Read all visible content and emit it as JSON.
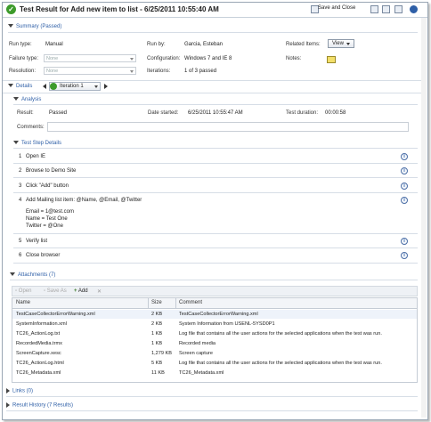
{
  "window": {
    "title": "Test Result for Add new item to list - 6/25/2011 10:55:40 AM",
    "save_close": "Save and Close"
  },
  "summary": {
    "header": "Summary (Passed)",
    "run_type_label": "Run type:",
    "run_type": "Manual",
    "run_by_label": "Run by:",
    "run_by": "Garcia, Esteban",
    "related_label": "Related Items:",
    "view_label": "View",
    "failure_label": "Failure type:",
    "failure_value": "None",
    "config_label": "Configuration:",
    "config": "Windows 7 and IE 8",
    "notes_label": "Notes:",
    "resolution_label": "Resolution:",
    "resolution_value": "None",
    "iterations_label": "Iterations:",
    "iterations": "1 of 3 passed"
  },
  "details": {
    "label": "Details",
    "iteration": "Iteration 1"
  },
  "analysis": {
    "header": "Analysis",
    "result_label": "Result:",
    "result": "Passed",
    "date_label": "Date started:",
    "date": "6/25/2011 10:55:47 AM",
    "duration_label": "Test duration:",
    "duration": "00:00:58",
    "comments_label": "Comments:"
  },
  "steps": {
    "header": "Test Step Details",
    "items": [
      {
        "num": "1",
        "text": "Open IE"
      },
      {
        "num": "2",
        "text": "Browse to Demo Site"
      },
      {
        "num": "3",
        "text": "Click \"Add\" button"
      },
      {
        "num": "4",
        "text": "Add Mailing list item: @Name, @Email, @Twitter"
      },
      {
        "num": "5",
        "text": "Verify list"
      },
      {
        "num": "6",
        "text": "Close browser"
      }
    ],
    "params": [
      "Email = 1@test.com",
      "Name = Test One",
      "Twitter = @One"
    ]
  },
  "attachments": {
    "header": "Attachments (7)",
    "toolbar": {
      "open": "Open",
      "save_as": "Save As",
      "add": "Add"
    },
    "columns": [
      "Name",
      "Size",
      "Comment"
    ],
    "rows": [
      {
        "name": "TestCaseCollectorErrorWarning.xml",
        "size": "2 KB",
        "comment": "TestCaseCollectorErrorWarning.xml"
      },
      {
        "name": "SystemInformation.xml",
        "size": "2 KB",
        "comment": "System Information from USENL-5YSD0P1"
      },
      {
        "name": "TC26_ActionLog.txt",
        "size": "1 KB",
        "comment": "Log file that contains all the user actions for the selected applications when the test was run."
      },
      {
        "name": "RecordedMedia.trmx",
        "size": "1 KB",
        "comment": "Recorded media"
      },
      {
        "name": "ScreenCapture.xesc",
        "size": "1,279 KB",
        "comment": "Screen capture"
      },
      {
        "name": "TC26_ActionLog.html",
        "size": "5 KB",
        "comment": "Log file that contains all the user actions for the selected applications when the test was run."
      },
      {
        "name": "TC26_Metadata.xml",
        "size": "11 KB",
        "comment": "TC26_Metadata.xml"
      }
    ]
  },
  "links": {
    "header": "Links (0)"
  },
  "history": {
    "header": "Result History (7 Results)"
  }
}
